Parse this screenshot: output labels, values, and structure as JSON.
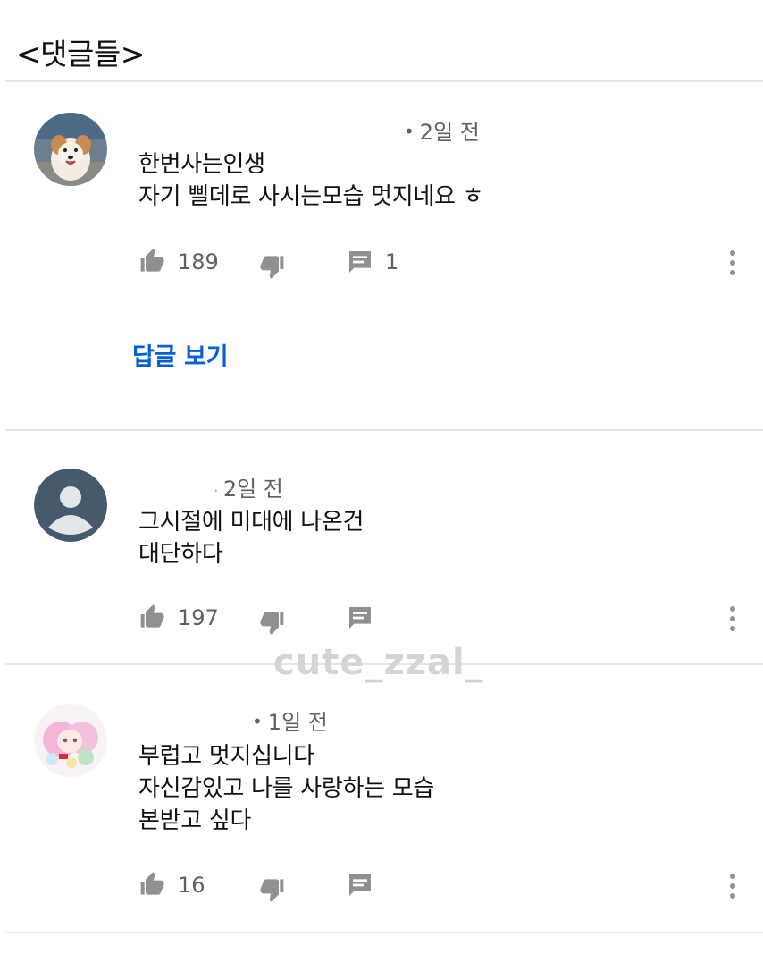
{
  "page": {
    "title": "<댓글들>"
  },
  "comments": [
    {
      "meta": "2일 전",
      "text": "한번사는인생\n자기 삘데로 사시는모습 멋지네요 ㅎ",
      "likes": "189",
      "replies": "1",
      "view_replies": "답글 보기",
      "avatar": "dog-photo"
    },
    {
      "meta": "2일 전",
      "text": "그시절에 미대에 나온건\n대단하다",
      "likes": "197",
      "replies": "",
      "avatar": "default-profile"
    },
    {
      "meta": "1일 전",
      "text": "부럽고 멋지십니다\n자신감있고 나를 사랑하는 모습\n본받고 싶다",
      "likes": "16",
      "replies": "",
      "avatar": "anime-girl"
    }
  ],
  "watermark": "cute_zzal_",
  "icons": [
    "thumb-up-icon",
    "thumb-down-icon",
    "comment-icon",
    "more-vert-icon"
  ],
  "colors": {
    "link": "#065fd4",
    "meta": "#606060",
    "icon": "#909090"
  }
}
